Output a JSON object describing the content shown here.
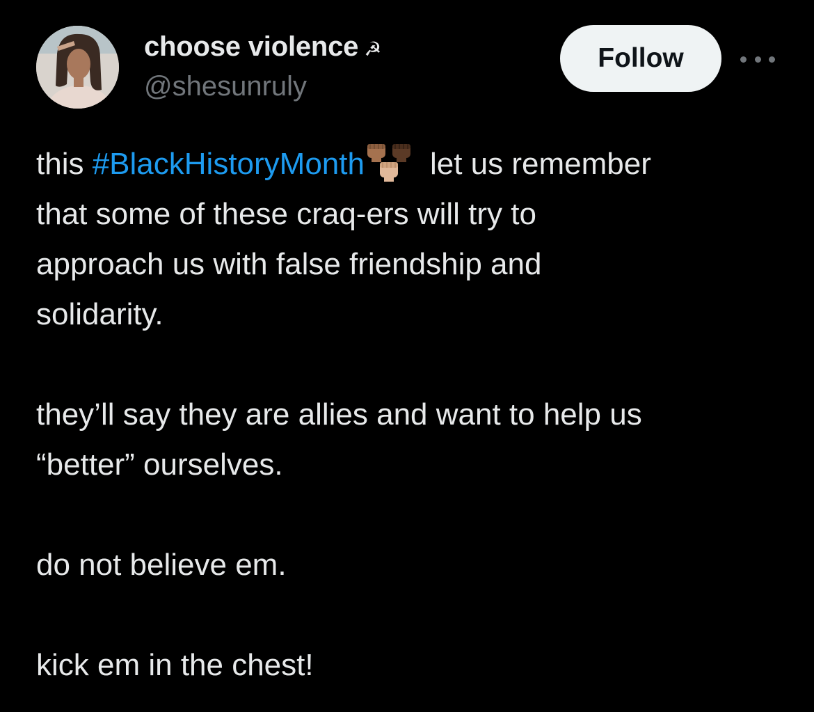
{
  "author": {
    "display_name": "choose violence",
    "name_emoji": "☭",
    "handle": "@shesunruly"
  },
  "actions": {
    "follow_label": "Follow",
    "more_icon": "more-horizontal-icon"
  },
  "tweet": {
    "paragraphs": [
      {
        "lines": [
          {
            "before": "this ",
            "hashtag": "#BlackHistoryMonth",
            "emoji": "raised-fists-icon",
            "after": "let us remember"
          },
          {
            "text": "that some of these craq-ers will try to"
          },
          {
            "text": "approach us with false friendship and"
          },
          {
            "text": "solidarity."
          }
        ]
      },
      {
        "lines": [
          {
            "text": "they’ll say they are allies and want to help us"
          },
          {
            "text": "“better” ourselves."
          }
        ]
      },
      {
        "lines": [
          {
            "text": "do not believe em."
          }
        ]
      },
      {
        "lines": [
          {
            "text": "kick em in the chest!"
          }
        ]
      }
    ]
  },
  "colors": {
    "background": "#000000",
    "text_primary": "#e7e9ea",
    "text_secondary": "#71767b",
    "link": "#1d9bf0",
    "follow_bg": "#eff3f4",
    "follow_text": "#0f1419"
  }
}
